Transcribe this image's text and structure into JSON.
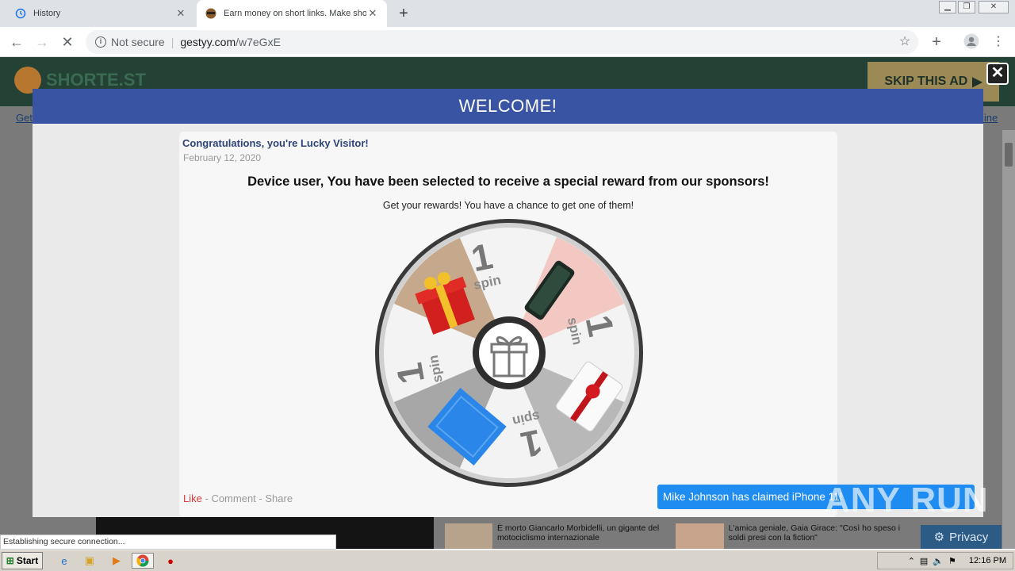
{
  "browser": {
    "tabs": [
      {
        "title": "History",
        "icon": "history-icon"
      },
      {
        "title": "Earn money on short links. Make sho",
        "icon": "ninja-favicon"
      }
    ],
    "address": {
      "security": "Not secure",
      "host": "gestyy.com",
      "path": "/w7eGxE"
    },
    "status_text": "Establishing secure connection..."
  },
  "site": {
    "logo_text": "SHORTE.ST",
    "skip_label": "SKIP THIS AD",
    "nav_left": "Get",
    "nav_right": "line",
    "privacy_label": "Privacy"
  },
  "modal": {
    "title": "WELCOME!",
    "congrats": "Congratulations, you're Lucky Visitor!",
    "date": "February 12, 2020",
    "headline": "Device user, You have been selected to receive a special reward from our sponsors!",
    "subheadline": "Get your rewards! You have a chance to get one of them!",
    "social": {
      "like": "Like",
      "comment": "Comment",
      "share": "Share"
    },
    "wheel": {
      "segments": [
        {
          "label_num": "1",
          "label_word": "spin"
        },
        {
          "prize": "iphone"
        },
        {
          "label_num": "1",
          "label_word": "spin"
        },
        {
          "prize": "gift-card"
        },
        {
          "label_num": "1",
          "label_word": "spin"
        },
        {
          "prize": "cash"
        },
        {
          "label_num": "1",
          "label_word": "spin"
        },
        {
          "prize": "gift-box"
        }
      ]
    }
  },
  "toast": "Mike Johnson has claimed iPhone 11!",
  "news": [
    {
      "text": "È morto Giancarlo Morbidelli, un gigante del motociclismo internazionale"
    },
    {
      "text": "L'amica geniale, Gaia Girace: \"Così ho speso i soldi presi con la fiction\""
    }
  ],
  "watermark": "ANY RUN",
  "taskbar": {
    "start": "Start",
    "clock": "12:16 PM"
  }
}
